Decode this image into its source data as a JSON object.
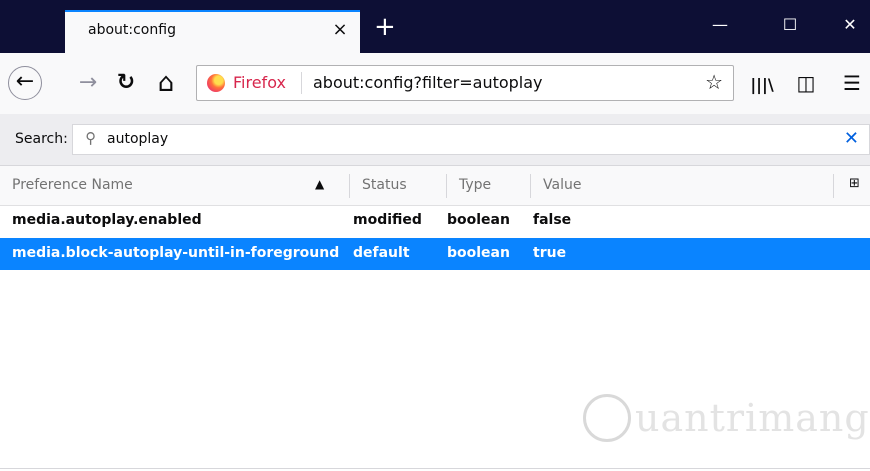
{
  "window": {
    "tab_title": "about:config",
    "tab_close": "×",
    "new_tab": "+",
    "minimize": "—",
    "maximize": "☐",
    "close": "✕"
  },
  "nav": {
    "back_icon": "←",
    "forward_icon": "→",
    "reload_icon": "↻",
    "home_icon": "⌂",
    "identity_label": "Firefox",
    "url": "about:config?filter=autoplay",
    "bookmark_icon": "☆",
    "library_icon": "|||\\",
    "sidebar_icon": "◫",
    "menu_icon": "☰"
  },
  "search": {
    "label": "Search:",
    "value": "autoplay",
    "clear_icon": "✕"
  },
  "table": {
    "columns": [
      "Preference Name",
      "Status",
      "Type",
      "Value"
    ],
    "sort_icon": "▲",
    "column_picker_icon": "⊞",
    "rows": [
      {
        "name": "media.autoplay.enabled",
        "status": "modified",
        "type": "boolean",
        "value": "false",
        "selected": false
      },
      {
        "name": "media.block-autoplay-until-in-foreground",
        "status": "default",
        "type": "boolean",
        "value": "true",
        "selected": true
      }
    ]
  },
  "watermark": {
    "text": "uantrimang"
  },
  "colors": {
    "titlebar": "#0d0f35",
    "selection": "#0a84ff",
    "firefox_label": "#d7264c",
    "clear_icon": "#0060df"
  }
}
